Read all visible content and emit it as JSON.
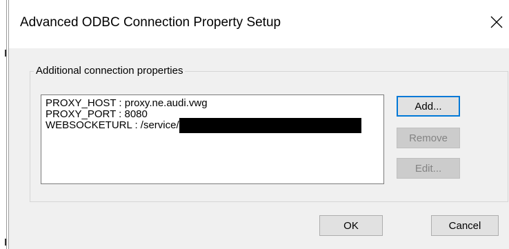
{
  "dialog": {
    "title": "Advanced ODBC Connection Property Setup",
    "close_glyph": "✕"
  },
  "group": {
    "label": "Additional connection properties"
  },
  "properties": [
    {
      "text": "PROXY_HOST : proxy.ne.audi.vwg"
    },
    {
      "text": "PROXY_PORT : 8080"
    },
    {
      "text": "WEBSOCKETURL : /service/"
    }
  ],
  "buttons": {
    "add": "Add...",
    "remove": "Remove",
    "edit": "Edit...",
    "ok": "OK",
    "cancel": "Cancel"
  }
}
